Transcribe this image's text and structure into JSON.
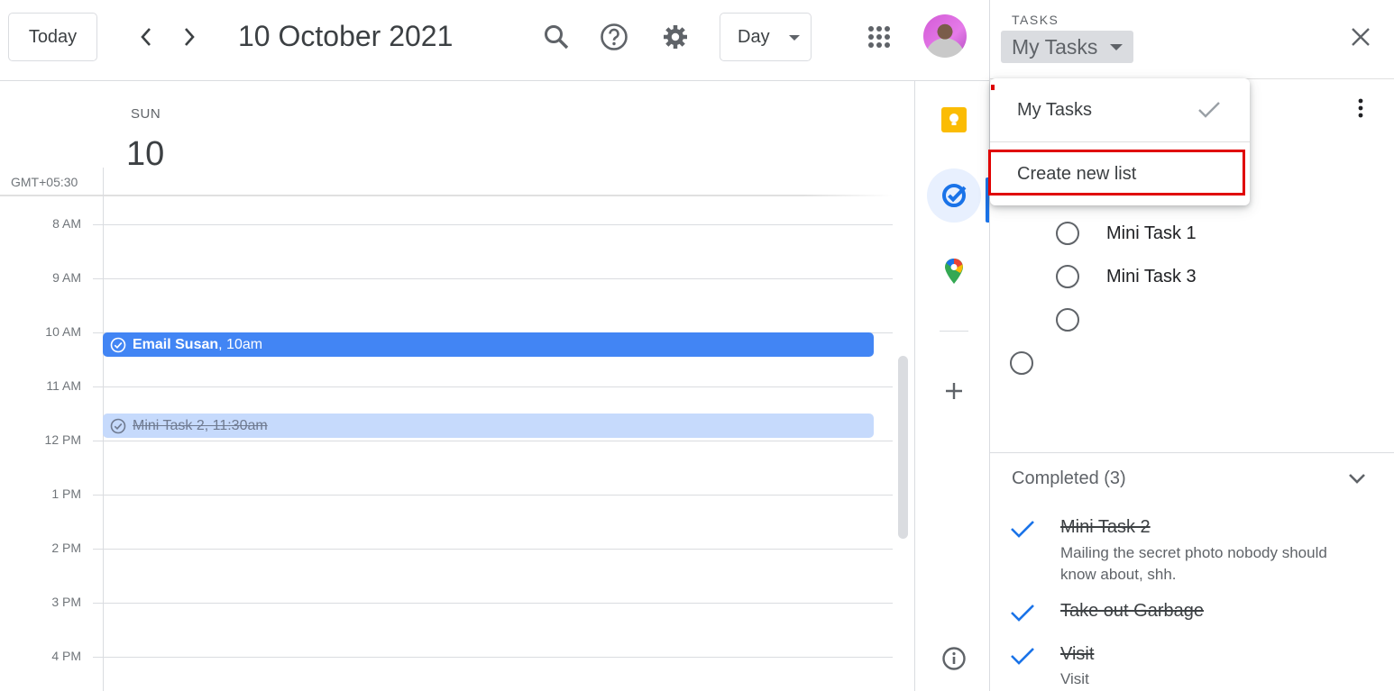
{
  "header": {
    "today_label": "Today",
    "date_title": "10 October 2021",
    "view_label": "Day"
  },
  "day": {
    "dow": "SUN",
    "number": "10",
    "timezone": "GMT+05:30"
  },
  "hours": [
    "8 AM",
    "9 AM",
    "10 AM",
    "11 AM",
    "12 PM",
    "1 PM",
    "2 PM",
    "3 PM",
    "4 PM"
  ],
  "events": [
    {
      "title": "Email Susan",
      "time": ", 10am"
    },
    {
      "title": "Mini Task 2, 11:30am"
    }
  ],
  "tasks_panel": {
    "kicker": "TASKS",
    "list_name": "My Tasks",
    "tasks": [
      "Mini Task 1",
      "Mini Task 3",
      "",
      ""
    ],
    "completed_heading": "Completed (3)",
    "completed": [
      {
        "title": "Mini Task 2",
        "note": "Mailing the secret photo nobody should know about, shh."
      },
      {
        "title": "Take out Garbage",
        "note": ""
      },
      {
        "title": "Visit",
        "note": "Visit"
      }
    ]
  },
  "menu": {
    "items": [
      "My Tasks",
      "Create new list"
    ]
  },
  "colors": {
    "event_primary": "#4285f4",
    "event_done": "#c6dafc",
    "accent": "#1a73e8",
    "highlight": "#e00000"
  }
}
